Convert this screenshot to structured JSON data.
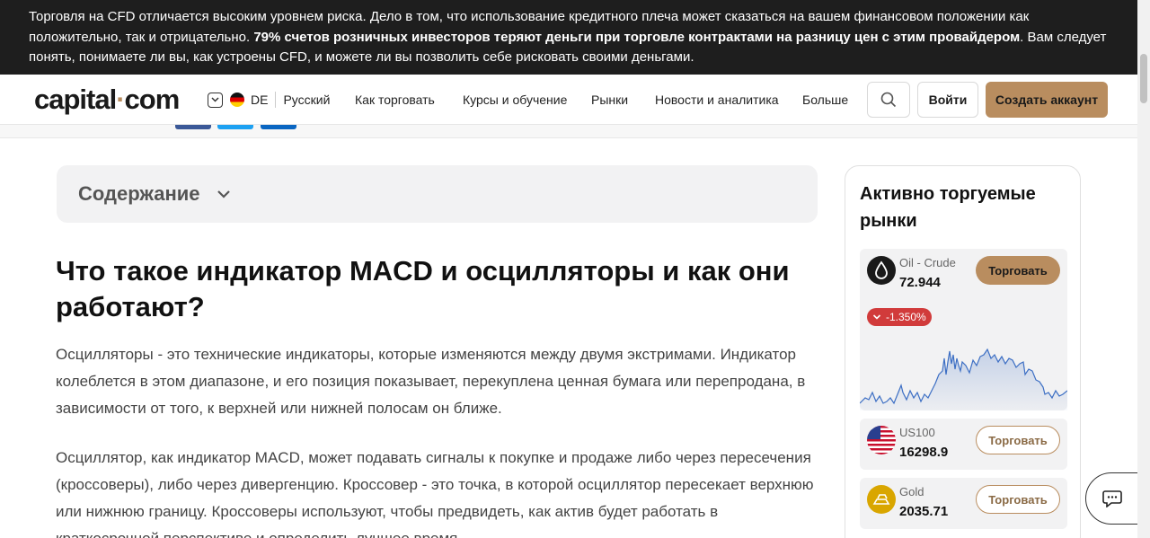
{
  "risk_banner": {
    "text_before": "Торговля на CFD отличается высоким уровнем риска. Дело в том, что использование кредитного плеча может сказаться на вашем финансовом положении как положительно, так и отрицательно.",
    "text_bold": "79% счетов розничных инвесторов теряют деньги при торговле контрактами на разницу цен с этим провайдером",
    "text_after": ". Вам следует понять, понимаете ли вы, как устроены CFD, и можете ли вы позволить себе рисковать своими деньгами."
  },
  "header": {
    "logo_left": "capital",
    "logo_dot": "·",
    "logo_right": "com",
    "country_code": "DE",
    "language": "Русский",
    "nav": [
      "Как торговать",
      "Курсы и обучение",
      "Рынки",
      "Новости и аналитика",
      "Больше"
    ],
    "login": "Войти",
    "signup": "Создать аккаунт"
  },
  "toc": {
    "label": "Содержание"
  },
  "article": {
    "title": "Что такое индикатор MACD и осцилляторы и как они работают?",
    "paragraphs": [
      "Осцилляторы - это технические индикаторы, которые изменяются между двумя экстримами. Индикатор колеблется в этом диапазоне, и его позиция показывает, перекуплена ценная бумага или перепродана, в зависимости от того, к верхней или нижней полосам он ближе.",
      "Осциллятор, как индикатор MACD, может подавать сигналы к покупке и продаже либо через пересечения (кроссоверы), либо через дивергенцию. Кроссовер - это точка, в которой осциллятор пересекает верхнюю или нижнюю границу. Кроссоверы используют, чтобы предвидеть, как актив будет работать в краткосрочной перспективе и определить лучшее время"
    ]
  },
  "sidebar": {
    "title": "Активно торгуемые рынки",
    "markets": [
      {
        "name": "Oil - Crude",
        "price": "72.944",
        "trade": "Торговать",
        "change": "-1.350%",
        "icon": "oil-drop-icon"
      },
      {
        "name": "US100",
        "price": "16298.9",
        "trade": "Торговать",
        "icon": "us-flag-icon"
      },
      {
        "name": "Gold",
        "price": "2035.71",
        "trade": "Торговать",
        "icon": "gold-bars-icon"
      }
    ]
  },
  "colors": {
    "accent": "#b98d5f",
    "banner_bg": "#1e1e1e",
    "negative": "#d13b3b",
    "chart_line": "#3d6fc4"
  }
}
